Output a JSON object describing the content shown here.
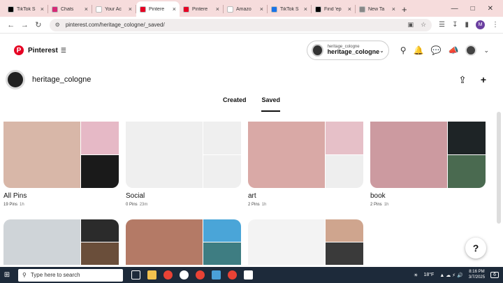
{
  "browser": {
    "tabs": [
      {
        "label": "TikTok S",
        "color": "#000000",
        "icon": "tiktok-icon"
      },
      {
        "label": "Chats",
        "color": "#d62976",
        "icon": "instagram-icon"
      },
      {
        "label": "Your Ac",
        "color": "#ffffff",
        "icon": "amazon-icon"
      },
      {
        "label": "Pintere",
        "color": "#e60023",
        "icon": "pinterest-icon",
        "active": true
      },
      {
        "label": "Pintere",
        "color": "#e60023",
        "icon": "pinterest-icon"
      },
      {
        "label": "Amazo",
        "color": "#ffffff",
        "icon": "amazon-icon"
      },
      {
        "label": "TikTok S",
        "color": "#1a73e8",
        "icon": "tiktok-icon"
      },
      {
        "label": "Find 'ep",
        "color": "#000000",
        "icon": "tiktok-icon"
      },
      {
        "label": "New Ta",
        "color": "#888888",
        "icon": "globe-icon"
      }
    ],
    "url": "pinterest.com/heritage_cologne/_saved/"
  },
  "header": {
    "brand": "Pinterest",
    "account_small": "heritage_cologne",
    "account_name": "heritage_cologne"
  },
  "profile": {
    "username": "heritage_cologne"
  },
  "profile_tabs": [
    "Created",
    "Saved"
  ],
  "boards": [
    {
      "title": "All Pins",
      "pins": "19 Pins",
      "age": "1h",
      "colors": [
        "#d8b7a8",
        "#e6b9c6",
        "#1a1a1a"
      ]
    },
    {
      "title": "Social",
      "pins": "0 Pins",
      "age": "23m",
      "colors": [
        "#efefef",
        "#efefef",
        "#efefef"
      ]
    },
    {
      "title": "art",
      "pins": "2 Pins",
      "age": "1h",
      "colors": [
        "#d9a9a6",
        "#e6c0c8",
        "#eeeeee"
      ]
    },
    {
      "title": "book",
      "pins": "2 Pins",
      "age": "1h",
      "colors": [
        "#cc9aa0",
        "#1e2426",
        "#4a6a50"
      ]
    }
  ],
  "boards_row2": [
    {
      "colors": [
        "#cfd4d8",
        "#2b2b2b",
        "#6a4e3a"
      ]
    },
    {
      "colors": [
        "#b47a66",
        "#4aa5d8",
        "#3e7d82"
      ]
    },
    {
      "colors": [
        "#f3f3f3",
        "#cfa58e",
        "#3a3a3a"
      ]
    }
  ],
  "taskbar": {
    "search_placeholder": "Type here to search",
    "weather": "18°F",
    "time": "8:16 PM",
    "date": "3/7/2025",
    "notifications": "6"
  }
}
